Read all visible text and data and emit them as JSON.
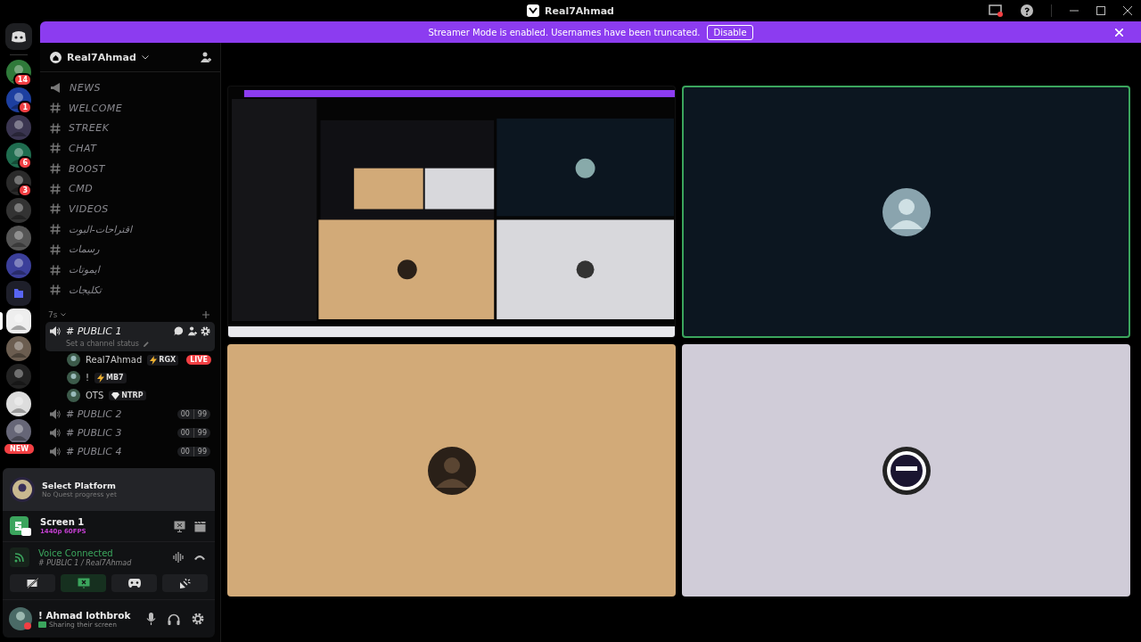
{
  "window": {
    "title": "Real7Ahmad"
  },
  "banner": {
    "text": "Streamer Mode is enabled. Usernames have been truncated.",
    "button": "Disable"
  },
  "servers": [
    {
      "selected": false,
      "badge": "14"
    },
    {
      "selected": false,
      "badge": "1"
    },
    {
      "selected": false
    },
    {
      "selected": false,
      "badge": "6"
    },
    {
      "selected": false,
      "badge": "3"
    },
    {
      "selected": false
    },
    {
      "selected": false
    },
    {
      "selected": false
    },
    {
      "selected": false,
      "kind": "folder"
    },
    {
      "selected": true
    },
    {
      "selected": false
    },
    {
      "selected": false
    },
    {
      "selected": false
    },
    {
      "selected": false,
      "badge": "NEW"
    }
  ],
  "server": {
    "name": "Real7Ahmad"
  },
  "channels": [
    {
      "kind": "announcement",
      "name": "NEWS"
    },
    {
      "kind": "text",
      "name": "WELCOME"
    },
    {
      "kind": "text",
      "name": "STREEK"
    },
    {
      "kind": "text",
      "name": "CHAT"
    },
    {
      "kind": "text",
      "name": "BOOST"
    },
    {
      "kind": "text",
      "name": "CMD"
    },
    {
      "kind": "text",
      "name": "VIDEOS"
    },
    {
      "kind": "text",
      "name": "اقتراحات-البوت"
    },
    {
      "kind": "text",
      "name": "رسمات"
    },
    {
      "kind": "text",
      "name": "ايموتات"
    },
    {
      "kind": "text",
      "name": "تكليجات"
    }
  ],
  "category": {
    "name": "7s"
  },
  "voice_channels": [
    {
      "name": "# PUBLIC 1",
      "selected": true,
      "status": "Set a channel status",
      "members": [
        {
          "name": "Real7Ahmad",
          "tag": "RGX",
          "kind": "bolt",
          "live": "LIVE"
        },
        {
          "name": "!",
          "tag": "MB7",
          "kind": "bolt"
        },
        {
          "name": "OTS",
          "tag": "NTRP",
          "kind": "gem"
        }
      ]
    },
    {
      "name": "# PUBLIC 2",
      "selected": false,
      "counts": [
        "00",
        "99"
      ]
    },
    {
      "name": "# PUBLIC 3",
      "selected": false,
      "counts": [
        "00",
        "99"
      ]
    },
    {
      "name": "# PUBLIC 4",
      "selected": false,
      "counts": [
        "00",
        "99"
      ]
    }
  ],
  "quest": {
    "title": "Select Platform",
    "subtitle": "No Quest progress yet"
  },
  "stream": {
    "title": "Screen 1",
    "quality": "1440p 60FPS"
  },
  "voice": {
    "status": "Voice Connected",
    "channel": "# PUBLIC 1 / Real7Ahmad"
  },
  "voice_buttons": [
    {
      "kind": "camera",
      "selected": false
    },
    {
      "kind": "screen",
      "selected": true
    },
    {
      "kind": "activity",
      "selected": false
    },
    {
      "kind": "soundboard",
      "selected": false
    }
  ],
  "user": {
    "name": "! Ahmad lothbrok",
    "status": "Sharing their screen"
  },
  "tiles": [
    {
      "kind": "stream",
      "speaking": false
    },
    {
      "kind": "avatar",
      "color": "#0c1620",
      "speaking": true
    },
    {
      "kind": "avatar",
      "color": "#d2aa78",
      "speaking": false
    },
    {
      "kind": "logo",
      "color": "#d0ccd8",
      "speaking": false
    }
  ]
}
